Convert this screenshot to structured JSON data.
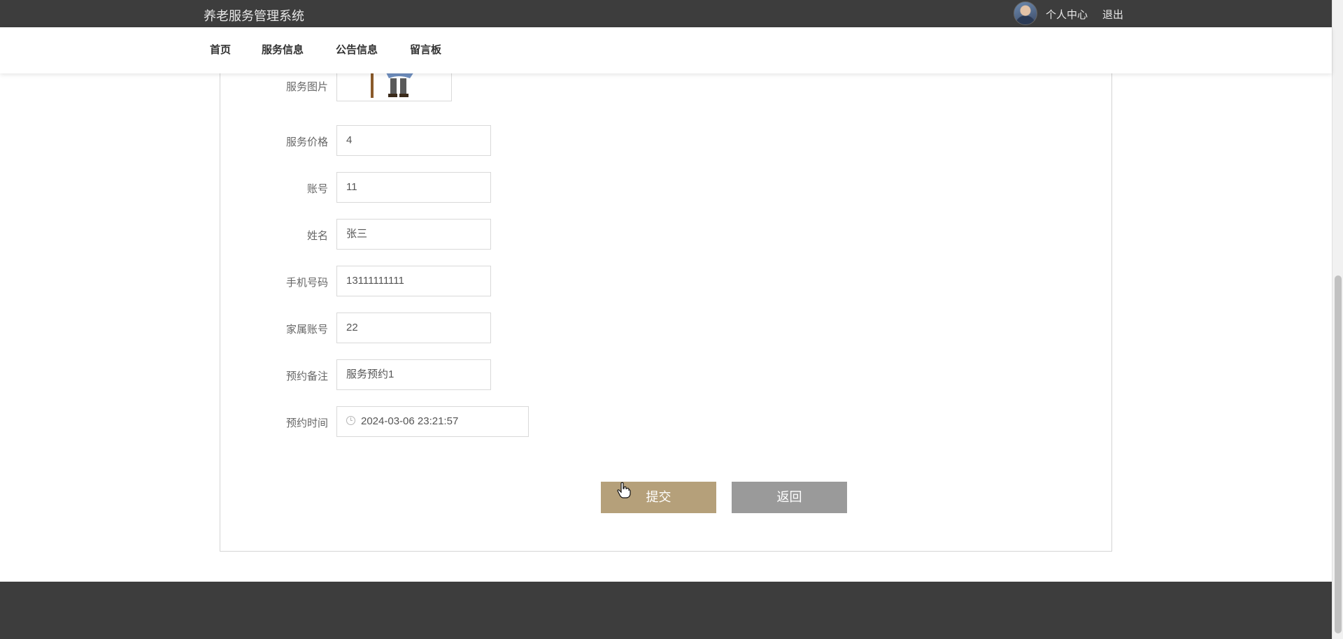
{
  "header": {
    "brand": "养老服务管理系统",
    "personal_center": "个人中心",
    "logout": "退出"
  },
  "nav": {
    "items": [
      "首页",
      "服务信息",
      "公告信息",
      "留言板"
    ]
  },
  "form": {
    "image_label": "服务图片",
    "fields": [
      {
        "label": "服务价格",
        "value": "4"
      },
      {
        "label": "账号",
        "value": "11"
      },
      {
        "label": "姓名",
        "value": "张三"
      },
      {
        "label": "手机号码",
        "value": "13111111111"
      },
      {
        "label": "家属账号",
        "value": "22"
      },
      {
        "label": "预约备注",
        "value": "服务预约1"
      }
    ],
    "time_field": {
      "label": "预约时间",
      "value": "2024-03-06 23:21:57"
    },
    "submit_label": "提交",
    "back_label": "返回"
  },
  "icons": {
    "time": "clock-icon",
    "avatar": "user-avatar"
  },
  "colors": {
    "header_bg": "#3d3d3d",
    "submit_bg": "#b5a07a",
    "back_bg": "#9a9a9a"
  }
}
